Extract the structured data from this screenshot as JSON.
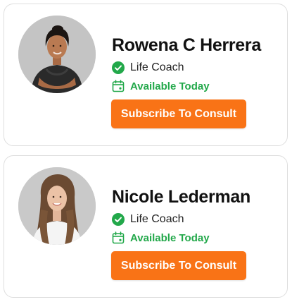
{
  "coaches": [
    {
      "name": "Rowena C Herrera",
      "role": "Life Coach",
      "availability": "Available Today",
      "button_label": "Subscribe To Consult",
      "avatar_icon": "avatar-photo-woman-dark-hair"
    },
    {
      "name": "Nicole Lederman",
      "role": "Life Coach",
      "availability": "Available Today",
      "button_label": "Subscribe To Consult",
      "avatar_icon": "avatar-photo-woman-long-hair"
    }
  ],
  "colors": {
    "accent": "#f97316",
    "available": "#22a84a",
    "card_border": "#dedede"
  }
}
